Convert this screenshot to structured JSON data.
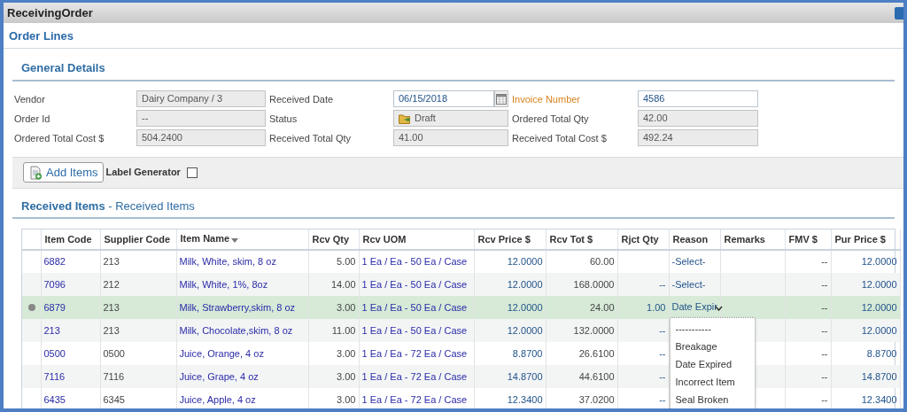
{
  "window": {
    "title": "ReceivingOrder"
  },
  "page_title": "Order Lines",
  "general_details": {
    "heading": "General Details",
    "fields": [
      {
        "label": "Vendor",
        "value": "Dairy Company / 3",
        "kind": "readonly",
        "required": false
      },
      {
        "label": "Received Date",
        "value": "06/15/2018",
        "kind": "date",
        "required": false
      },
      {
        "label": "Invoice Number",
        "value": "4586",
        "kind": "input",
        "required": true
      },
      {
        "label": "Order Id",
        "value": "--",
        "kind": "readonly",
        "required": false
      },
      {
        "label": "Status",
        "value": "Draft",
        "kind": "status",
        "required": false
      },
      {
        "label": "Ordered Total Qty",
        "value": "42.00",
        "kind": "readonly",
        "required": false
      },
      {
        "label": "Ordered Total Cost $",
        "value": "504.2400",
        "kind": "readonly",
        "required": false
      },
      {
        "label": "Received Total Qty",
        "value": "41.00",
        "kind": "readonly",
        "required": false
      },
      {
        "label": "Received Total Cost $",
        "value": "492.24",
        "kind": "readonly",
        "required": false
      }
    ]
  },
  "toolbar": {
    "add_button": "Add Items",
    "label_generator": {
      "label": "Label Generator",
      "checked": false
    }
  },
  "received_items": {
    "heading": "Received Items",
    "subheading": " - Received Items",
    "columns": [
      {
        "label": "Item Code",
        "sorted": false
      },
      {
        "label": "Supplier Code",
        "sorted": false
      },
      {
        "label": "Item Name",
        "sorted": true
      },
      {
        "label": "Rcv Qty",
        "sorted": false
      },
      {
        "label": "Rcv UOM",
        "sorted": false
      },
      {
        "label": "Rcv Price $",
        "sorted": false
      },
      {
        "label": "Rcv Tot $",
        "sorted": false
      },
      {
        "label": "Rjct Qty",
        "sorted": false
      },
      {
        "label": "Reason",
        "sorted": false
      },
      {
        "label": "Remarks",
        "sorted": false
      },
      {
        "label": "FMV $",
        "sorted": false
      },
      {
        "label": "Pur Price $",
        "sorted": false
      }
    ],
    "rows": [
      {
        "selected": false,
        "item_code": "6882",
        "supplier_code": "213",
        "item_name": "Milk, White, skim, 8 oz",
        "rcv_qty": "5.00",
        "rcv_uom": "1 Ea / Ea - 50 Ea / Case",
        "rcv_price": "12.0000",
        "rcv_tot": "60.00",
        "reason": {
          "text": "-Select-",
          "expanded": false
        },
        "fmv": "--",
        "pur_price": "12.0000"
      },
      {
        "selected": false,
        "item_code": "7096",
        "supplier_code": "212",
        "item_name": "Milk, White, 1%, 8oz",
        "rcv_qty": "14.00",
        "rcv_uom": "1 Ea / Ea - 50 Ea / Case",
        "rcv_price": "12.0000",
        "rcv_tot": "168.0000",
        "rjct_qty": "--",
        "reason": {
          "text": "-Select-",
          "expanded": false
        },
        "fmv": "--",
        "pur_price": "12.0000"
      },
      {
        "selected": true,
        "item_code": "6879",
        "supplier_code": "213",
        "item_name": "Milk, Strawberry,skim, 8 oz",
        "rcv_qty": "3.00",
        "rcv_uom": "1 Ea / Ea - 50 Ea / Case",
        "rcv_price": "12.0000",
        "rcv_tot": "24.00",
        "rjct_qty": "1.00",
        "reason": {
          "text": "Date Expir",
          "expanded": true
        },
        "fmv": "--",
        "pur_price": "12.0000"
      },
      {
        "selected": false,
        "item_code": "213",
        "supplier_code": "213",
        "item_name": "Milk, Chocolate,skim, 8 oz",
        "rcv_qty": "11.00",
        "rcv_uom": "1 Ea / Ea - 50 Ea / Case",
        "rcv_price": "12.0000",
        "rcv_tot": "132.0000",
        "rjct_qty": "--",
        "fmv": "--",
        "pur_price": "12.0000"
      },
      {
        "selected": false,
        "item_code": "0500",
        "supplier_code": "0500",
        "item_name": "Juice, Orange, 4 oz",
        "rcv_qty": "3.00",
        "rcv_uom": "1 Ea / Ea - 72 Ea / Case",
        "rcv_price": "8.8700",
        "rcv_tot": "26.6100",
        "rjct_qty": "--",
        "fmv": "--",
        "pur_price": "8.8700"
      },
      {
        "selected": false,
        "item_code": "7116",
        "supplier_code": "7116",
        "item_name": "Juice, Grape, 4 oz",
        "rcv_qty": "3.00",
        "rcv_uom": "1 Ea / Ea - 72 Ea / Case",
        "rcv_price": "14.8700",
        "rcv_tot": "44.6100",
        "rjct_qty": "--",
        "fmv": "--",
        "pur_price": "14.8700"
      },
      {
        "selected": false,
        "item_code": "6435",
        "supplier_code": "6345",
        "item_name": "Juice, Apple, 4 oz",
        "rcv_qty": "3.00",
        "rcv_uom": "1 Ea / Ea - 72 Ea / Case",
        "rcv_price": "12.3400",
        "rcv_tot": "37.0200",
        "rjct_qty": "--",
        "fmv": "--",
        "pur_price": "12.3400"
      }
    ],
    "reason_options": [
      "-----------",
      "Breakage",
      "Date Expired",
      "Incorrect Item",
      "Seal Broken"
    ]
  }
}
